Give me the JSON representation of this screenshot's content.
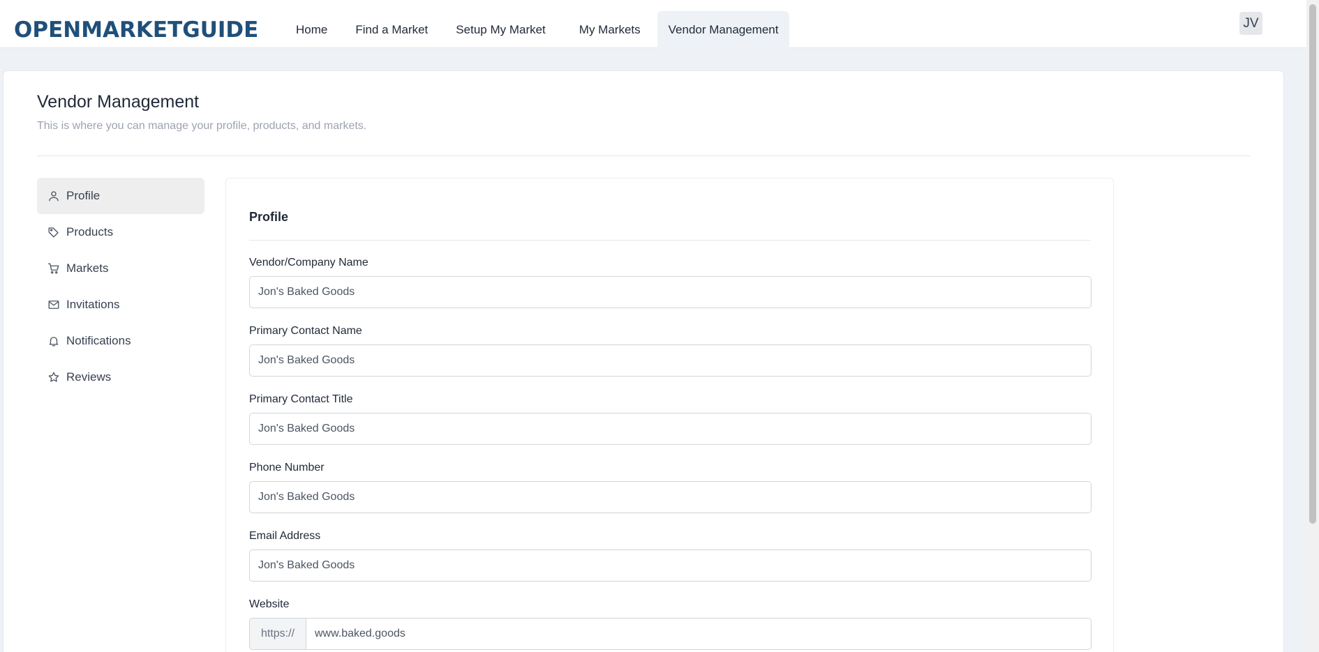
{
  "brand": {
    "logo_text": "OPENMARKETGUIDE",
    "color": "#1f4f7a"
  },
  "nav": {
    "items": [
      {
        "label": "Home"
      },
      {
        "label": "Find a Market"
      },
      {
        "label": "Setup My Market"
      },
      {
        "label": "My Markets"
      },
      {
        "label": "Vendor Management"
      }
    ],
    "active_index": 4
  },
  "user": {
    "initials": "JV"
  },
  "page": {
    "title": "Vendor Management",
    "subtitle": "This is where you can manage your profile, products, and markets."
  },
  "sidebar": {
    "items": [
      {
        "label": "Profile",
        "icon": "user-icon"
      },
      {
        "label": "Products",
        "icon": "tag-icon"
      },
      {
        "label": "Markets",
        "icon": "cart-icon"
      },
      {
        "label": "Invitations",
        "icon": "mail-icon"
      },
      {
        "label": "Notifications",
        "icon": "bell-icon"
      },
      {
        "label": "Reviews",
        "icon": "star-icon"
      }
    ],
    "active_index": 0
  },
  "form": {
    "title": "Profile",
    "fields": [
      {
        "label": "Vendor/Company Name",
        "value": "Jon's Baked Goods"
      },
      {
        "label": "Primary Contact Name",
        "value": "Jon's Baked Goods"
      },
      {
        "label": "Primary Contact Title",
        "value": "Jon's Baked Goods"
      },
      {
        "label": "Phone Number",
        "value": "Jon's Baked Goods"
      },
      {
        "label": "Email Address",
        "value": "Jon's Baked Goods"
      }
    ],
    "website": {
      "label": "Website",
      "prefix": "https://",
      "value": "www.baked.goods"
    }
  }
}
